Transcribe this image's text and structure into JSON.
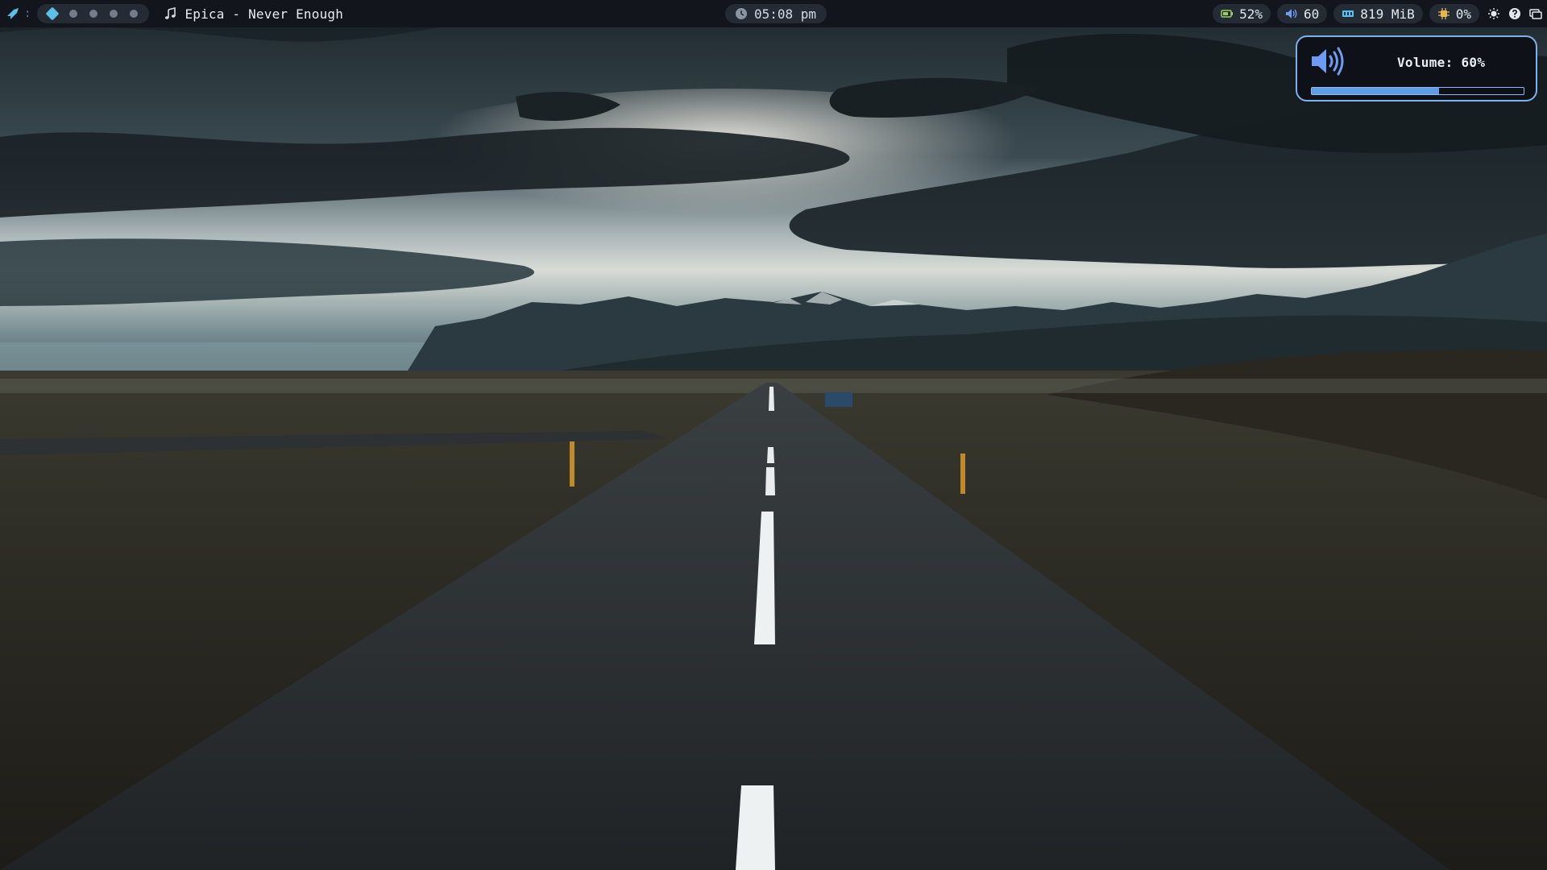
{
  "topbar": {
    "separator": ":",
    "workspaces": [
      {
        "name": "workspace-1",
        "active": true
      },
      {
        "name": "workspace-2",
        "active": false
      },
      {
        "name": "workspace-3",
        "active": false
      },
      {
        "name": "workspace-4",
        "active": false
      },
      {
        "name": "workspace-5",
        "active": false
      }
    ],
    "media": {
      "icon": "music-note-icon",
      "track": "Epica - Never Enough"
    },
    "clock": {
      "icon": "clock-icon",
      "time": "05:08 pm"
    },
    "modules": {
      "battery": {
        "icon": "battery-icon",
        "value": "52%"
      },
      "volume": {
        "icon": "speaker-icon",
        "value": "60"
      },
      "memory": {
        "icon": "memory-icon",
        "value": "819 MiB"
      },
      "cpu": {
        "icon": "cpu-icon",
        "value": "0%"
      }
    },
    "tray": [
      "brightness-icon",
      "help-icon",
      "display-icon"
    ]
  },
  "osd": {
    "icon": "speaker-loud-icon",
    "label": "Volume: 60%",
    "level": 0.6
  },
  "colors": {
    "bar_bg": "#12151b",
    "pill_bg": "#252b35",
    "accent": "#5ac0e8",
    "osd_border": "#7fb0ee",
    "osd_fill": "#5f9de7",
    "battery_green": "#9ccc65",
    "volume_blue": "#6f9bf2",
    "memory_cyan": "#4fc3f7",
    "cpu_amber": "#e6b450"
  }
}
